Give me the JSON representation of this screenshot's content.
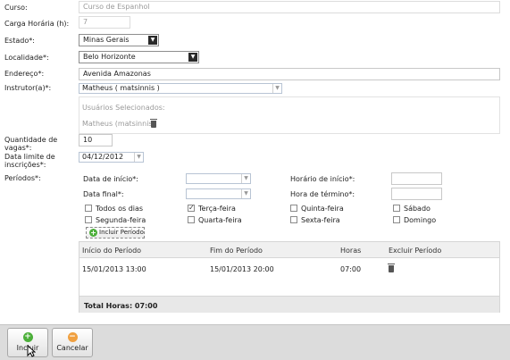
{
  "labels": {
    "curso": "Curso:",
    "carga": "Carga Horária (h):",
    "estado": "Estado*:",
    "localidade": "Localidade*:",
    "endereco": "Endereço*:",
    "instrutor": "Instrutor(a)*:",
    "qtd": "Quantidade de vagas*:",
    "data_limite": "Data limite de inscrições*:",
    "periodos": "Períodos*:"
  },
  "fields": {
    "curso": "Curso de Espanhol",
    "carga": "7",
    "estado": "Minas Gerais",
    "localidade": "Belo Horizonte",
    "endereco": "Avenida Amazonas",
    "instrutor": "Matheus ( matsinnis )",
    "usuarios_title": "Usuários Selecionados:",
    "usuario": "Matheus (matsinnis)",
    "qtd": "10",
    "data_limite": "04/12/2012"
  },
  "periodo_form": {
    "data_inicio": "Data de início*:",
    "data_final": "Data final*:",
    "horario_inicio": "Horário de início*:",
    "hora_termino": "Hora de término*:",
    "incluir": "Incluir Período"
  },
  "days": [
    {
      "label": "Todos os dias",
      "checked": false
    },
    {
      "label": "Terça-feira",
      "checked": true
    },
    {
      "label": "Quinta-feira",
      "checked": false
    },
    {
      "label": "Sábado",
      "checked": false
    },
    {
      "label": "Segunda-feira",
      "checked": false
    },
    {
      "label": "Quarta-feira",
      "checked": false
    },
    {
      "label": "Sexta-feira",
      "checked": false
    },
    {
      "label": "Domingo",
      "checked": false
    }
  ],
  "table": {
    "headers": [
      "Início do Período",
      "Fim do Período",
      "Horas",
      "Excluir Período"
    ],
    "rows": [
      [
        "15/01/2013 13:00",
        "15/01/2013 20:00",
        "07:00"
      ]
    ],
    "total": "Total Horas: 07:00"
  },
  "buttons": {
    "incluir": "Incluir",
    "cancelar": "Cancelar"
  }
}
